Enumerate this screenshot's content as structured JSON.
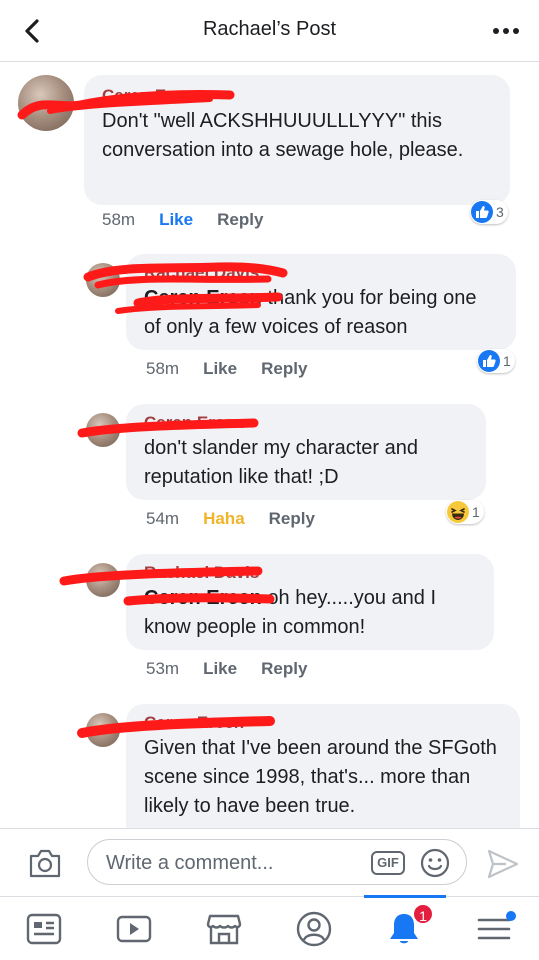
{
  "header": {
    "title": "Rachael’s Post",
    "back_icon": "chevron-left-icon",
    "more_icon": "more-dots-icon"
  },
  "comments": [
    {
      "author": "Ceren Ercen",
      "text": "Don't \"well ACKSHHUUULLLYYY\" this conversation into a sewage hole, please.",
      "time": "58m",
      "like_label": "Like",
      "reply_label": "Reply",
      "reaction_type": "like",
      "reaction_count": "3"
    },
    {
      "author": "Rachael Davis",
      "mention": "Ceren Ercen",
      "text": "thank you for being one of only a few voices of reason",
      "time": "58m",
      "like_label": "Like",
      "reply_label": "Reply",
      "reaction_type": "like",
      "reaction_count": "1"
    },
    {
      "author": "Ceren Ercen",
      "text": "don't slander my character and reputation like that! ;D",
      "time": "54m",
      "like_label": "Haha",
      "reply_label": "Reply",
      "reaction_type": "haha",
      "reaction_count": "1"
    },
    {
      "author": "Rachael Davis",
      "mention": "Ceren Ercen",
      "text": "oh hey.....you and I know people in common!",
      "time": "53m",
      "like_label": "Like",
      "reply_label": "Reply"
    },
    {
      "author": "Ceren Ercen",
      "text": "Given that I've been around the SFGoth scene since 1998, that's... more than likely to have been true."
    }
  ],
  "composer": {
    "placeholder": "Write a comment...",
    "gif_label": "GIF"
  },
  "tabbar": {
    "notification_count": "1",
    "active_tab": "notifications"
  },
  "colors": {
    "accent": "#1877f2",
    "redaction": "#ff1a1a",
    "haha": "#f0b429",
    "badge": "#e41e3f"
  }
}
